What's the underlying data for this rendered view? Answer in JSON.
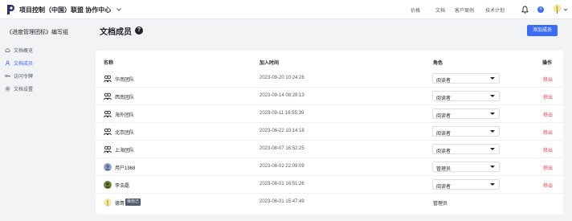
{
  "app": {
    "title": "项目控制（中国）联盟 协作中心",
    "brand_color": "#3b6cf6",
    "danger_color": "#e5484d"
  },
  "topnav": {
    "links": [
      "价格",
      "文档",
      "客户案例",
      "技术计划"
    ],
    "plus_label": "+"
  },
  "sidebar": {
    "project": "《进度管理团标》编写组",
    "items": [
      {
        "label": "文档概览",
        "icon": "cloud-icon",
        "active": false
      },
      {
        "label": "文档成员",
        "icon": "person-icon",
        "active": true
      },
      {
        "label": "访问令牌",
        "icon": "key-icon",
        "active": false
      },
      {
        "label": "文档设置",
        "icon": "gear-icon",
        "active": false
      }
    ]
  },
  "main": {
    "title": "文档成员",
    "help_label": "?",
    "add_button": "添加成员",
    "columns": {
      "name": "名称",
      "joined": "加入时间",
      "role": "角色",
      "action": "操作"
    },
    "rows": [
      {
        "name": "华南团队",
        "icon": "team-icon",
        "time": "2023-09-20 10:24:28",
        "role": "阅读者",
        "editable": true,
        "action": "移出"
      },
      {
        "name": "西南团队",
        "icon": "team-icon",
        "time": "2023-09-14 08:29:13",
        "role": "阅读者",
        "editable": true,
        "action": "移出"
      },
      {
        "name": "海外团队",
        "icon": "team-icon",
        "time": "2023-09-11 16:55:39",
        "role": "阅读者",
        "editable": true,
        "action": "移出"
      },
      {
        "name": "北京团队",
        "icon": "team-icon",
        "time": "2023-08-22 10:14:18",
        "role": "阅读者",
        "editable": true,
        "action": "移出"
      },
      {
        "name": "上海团队",
        "icon": "team-icon",
        "time": "2023-08-07 16:52:25",
        "role": "阅读者",
        "editable": true,
        "action": "移出"
      },
      {
        "name": "用户1968",
        "icon": "user-avatar-icon",
        "time": "2023-08-02 22:09:09",
        "role": "管理员",
        "editable": true,
        "action": "移出"
      },
      {
        "name": "李浩磊",
        "icon": "user-avatar-icon",
        "time": "2023-08-01 16:51:26",
        "role": "阅读者",
        "editable": true,
        "action": "移出"
      },
      {
        "name": "德哥",
        "tag": "我自己",
        "icon": "self-avatar-icon",
        "time": "2023-08-01 15:47:49",
        "role": "管理员",
        "editable": false,
        "action": ""
      }
    ]
  }
}
